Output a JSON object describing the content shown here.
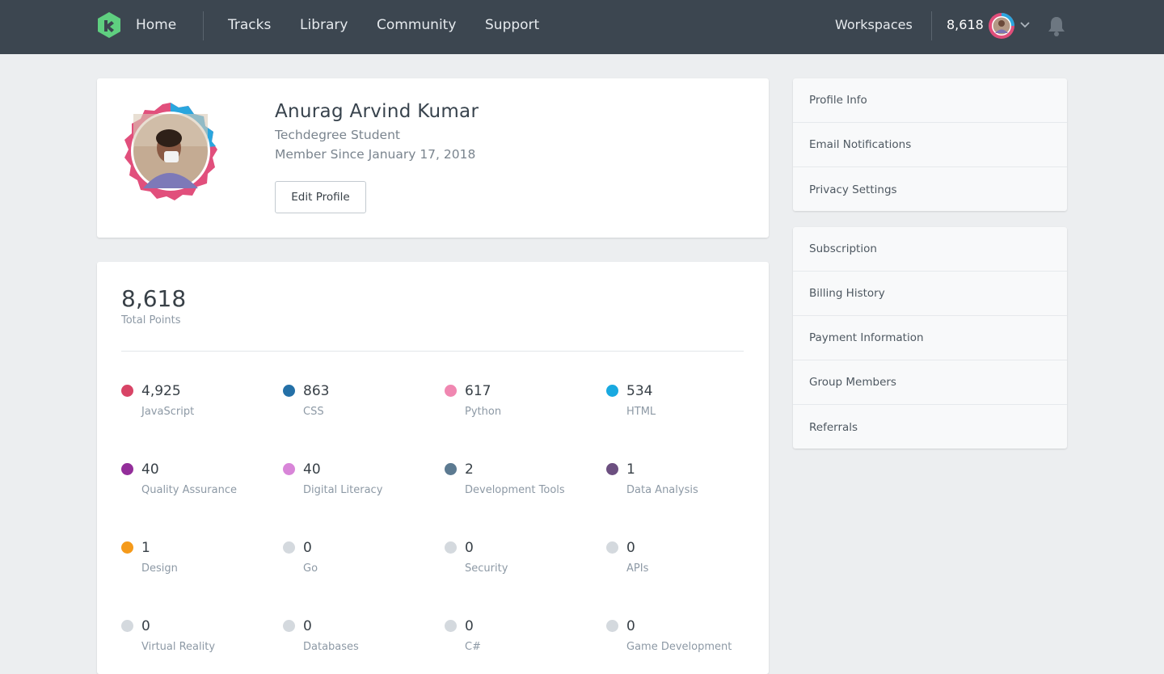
{
  "topbar": {
    "home_label": "Home",
    "nav_items": [
      "Tracks",
      "Library",
      "Community",
      "Support"
    ],
    "workspaces_label": "Workspaces",
    "points": "8,618",
    "icons": [
      "treehouse-logo-icon",
      "avatar-icon",
      "chevron-down-icon",
      "bell-icon"
    ]
  },
  "profile": {
    "name": "Anurag Arvind Kumar",
    "role": "Techdegree Student",
    "member_since": "Member Since January 17, 2018",
    "edit_button": "Edit Profile"
  },
  "points": {
    "total_value": "8,618",
    "total_label": "Total Points",
    "topics": [
      {
        "value": "4,925",
        "label": "JavaScript",
        "color": "#d84466"
      },
      {
        "value": "863",
        "label": "CSS",
        "color": "#2470a7"
      },
      {
        "value": "617",
        "label": "Python",
        "color": "#f087b1"
      },
      {
        "value": "534",
        "label": "HTML",
        "color": "#19a9e0"
      },
      {
        "value": "40",
        "label": "Quality Assurance",
        "color": "#932e9a"
      },
      {
        "value": "40",
        "label": "Digital Literacy",
        "color": "#d885d8"
      },
      {
        "value": "2",
        "label": "Development Tools",
        "color": "#5c7a91"
      },
      {
        "value": "1",
        "label": "Data Analysis",
        "color": "#6c4f80"
      },
      {
        "value": "1",
        "label": "Design",
        "color": "#f59a1a"
      },
      {
        "value": "0",
        "label": "Go",
        "color": "#d4d9de"
      },
      {
        "value": "0",
        "label": "Security",
        "color": "#d4d9de"
      },
      {
        "value": "0",
        "label": "APIs",
        "color": "#d4d9de"
      },
      {
        "value": "0",
        "label": "Virtual Reality",
        "color": "#d4d9de"
      },
      {
        "value": "0",
        "label": "Databases",
        "color": "#d4d9de"
      },
      {
        "value": "0",
        "label": "C#",
        "color": "#d4d9de"
      },
      {
        "value": "0",
        "label": "Game Development",
        "color": "#d4d9de"
      }
    ]
  },
  "settings_menu": {
    "group1": [
      "Profile Info",
      "Email Notifications",
      "Privacy Settings"
    ],
    "group2": [
      "Subscription",
      "Billing History",
      "Payment Information",
      "Group Members",
      "Referrals"
    ]
  },
  "colors": {
    "topbar": "#3c4650",
    "brand": "#5fcf80",
    "background": "#eceef0"
  }
}
